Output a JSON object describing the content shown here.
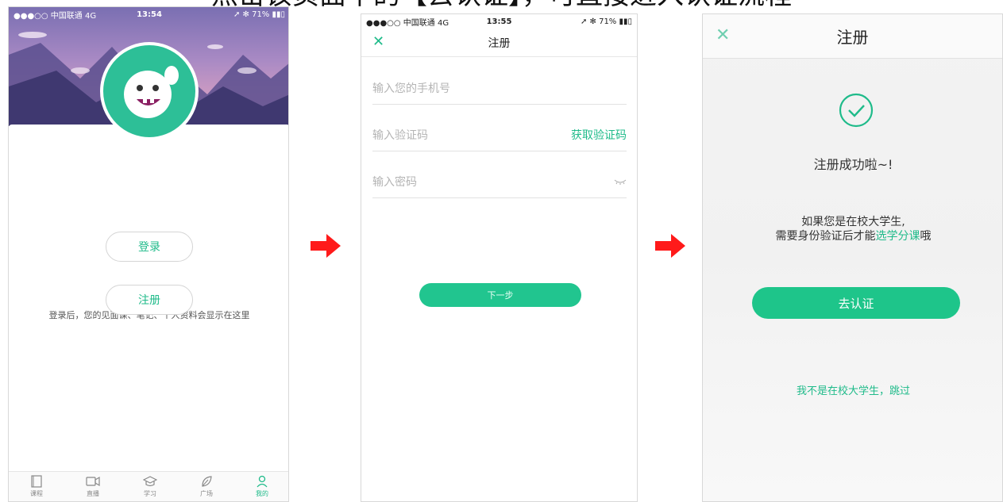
{
  "heading": {
    "text": "点击该页面中的【去认证】，可直接进入认证流程"
  },
  "phone1": {
    "status": {
      "carrier": "●●●○○ 中国联通  4G",
      "time": "13:54",
      "right": "➚ ✻ 71% ▮▮▯"
    },
    "info_text": "登录后，您的见面课、笔记、个人资料会显示在这里",
    "login_label": "登录",
    "register_label": "注册",
    "tabs": [
      {
        "label": "课程",
        "icon": "book-icon"
      },
      {
        "label": "直播",
        "icon": "video-icon"
      },
      {
        "label": "学习",
        "icon": "graduation-cap-icon"
      },
      {
        "label": "广场",
        "icon": "leaf-icon"
      },
      {
        "label": "我的",
        "icon": "person-icon"
      }
    ]
  },
  "phone2": {
    "status": {
      "carrier": "●●●○○ 中国联通  4G",
      "time": "13:55",
      "right": "➚ ✻ 71% ▮▮▯"
    },
    "title": "注册",
    "phone_placeholder": "输入您的手机号",
    "code_placeholder": "输入验证码",
    "get_code_label": "获取验证码",
    "password_placeholder": "输入密码",
    "next_label": "下一步"
  },
  "phone3": {
    "title": "注册",
    "success_text": "注册成功啦~!",
    "hint_line1": "如果您是在校大学生,",
    "hint_line2_prefix": "需要身份验证后才能",
    "hint_line2_highlight": "选学分课",
    "hint_line2_suffix": "哦",
    "verify_label": "去认证",
    "skip_label": "我不是在校大学生，跳过"
  },
  "colors": {
    "accent": "#1fbb8a",
    "arrow": "#ff1a1a"
  }
}
